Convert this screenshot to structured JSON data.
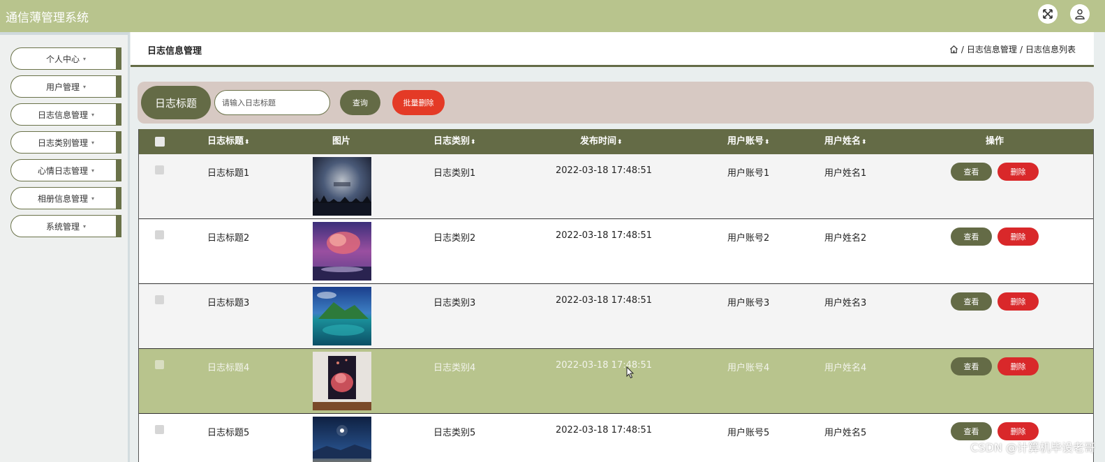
{
  "app": {
    "title": "通信薄管理系统"
  },
  "topbar": {
    "fullscreen_icon": "fullscreen-icon",
    "user_icon": "user-icon"
  },
  "sidebar": {
    "items": [
      {
        "label": "个人中心"
      },
      {
        "label": "用户管理"
      },
      {
        "label": "日志信息管理"
      },
      {
        "label": "日志类别管理"
      },
      {
        "label": "心情日志管理"
      },
      {
        "label": "相册信息管理"
      },
      {
        "label": "系统管理"
      }
    ],
    "caret": "▾"
  },
  "breadcrumb": {
    "page_title": "日志信息管理",
    "home_icon": "home-icon",
    "path": [
      "日志信息管理",
      "日志信息列表"
    ],
    "separator": "/"
  },
  "search": {
    "label": "日志标题",
    "placeholder": "请输入日志标题",
    "query_button": "查询",
    "batch_delete_button": "批量删除"
  },
  "table": {
    "headers": {
      "title": "日志标题",
      "image": "图片",
      "category": "日志类别",
      "publish_time": "发布时间",
      "account": "用户账号",
      "name": "用户姓名",
      "actions": "操作"
    },
    "sort_glyph": "⬍",
    "rows": [
      {
        "title": "日志标题1",
        "image": "night-sky-thumbnail",
        "category": "日志类别1",
        "publish_time": "2022-03-18 17:48:51",
        "account": "用户账号1",
        "name": "用户姓名1",
        "view": "查看",
        "delete": "删除"
      },
      {
        "title": "日志标题2",
        "image": "pink-cloud-thumbnail",
        "category": "日志类别2",
        "publish_time": "2022-03-18 17:48:51",
        "account": "用户账号2",
        "name": "用户姓名2",
        "view": "查看",
        "delete": "删除"
      },
      {
        "title": "日志标题3",
        "image": "island-lake-thumbnail",
        "category": "日志类别3",
        "publish_time": "2022-03-18 17:48:51",
        "account": "用户账号3",
        "name": "用户姓名3",
        "view": "查看",
        "delete": "删除"
      },
      {
        "title": "日志标题4",
        "image": "framed-art-thumbnail",
        "category": "日志类别4",
        "publish_time": "2022-03-18 17:48:51",
        "account": "用户账号4",
        "name": "用户姓名4",
        "view": "查看",
        "delete": "删除"
      },
      {
        "title": "日志标题5",
        "image": "moon-lake-thumbnail",
        "category": "日志类别5",
        "publish_time": "2022-03-18 17:48:51",
        "account": "用户账号5",
        "name": "用户姓名5",
        "view": "查看",
        "delete": "删除"
      }
    ],
    "highlighted_row": 4
  },
  "watermark": "CSDN @计算机毕设老哥",
  "colors": {
    "topbar": "#b8c48d",
    "accent": "#646b46",
    "danger": "#d9282a",
    "search_panel": "#d7c9c3",
    "row_highlight": "#b8c48d"
  }
}
